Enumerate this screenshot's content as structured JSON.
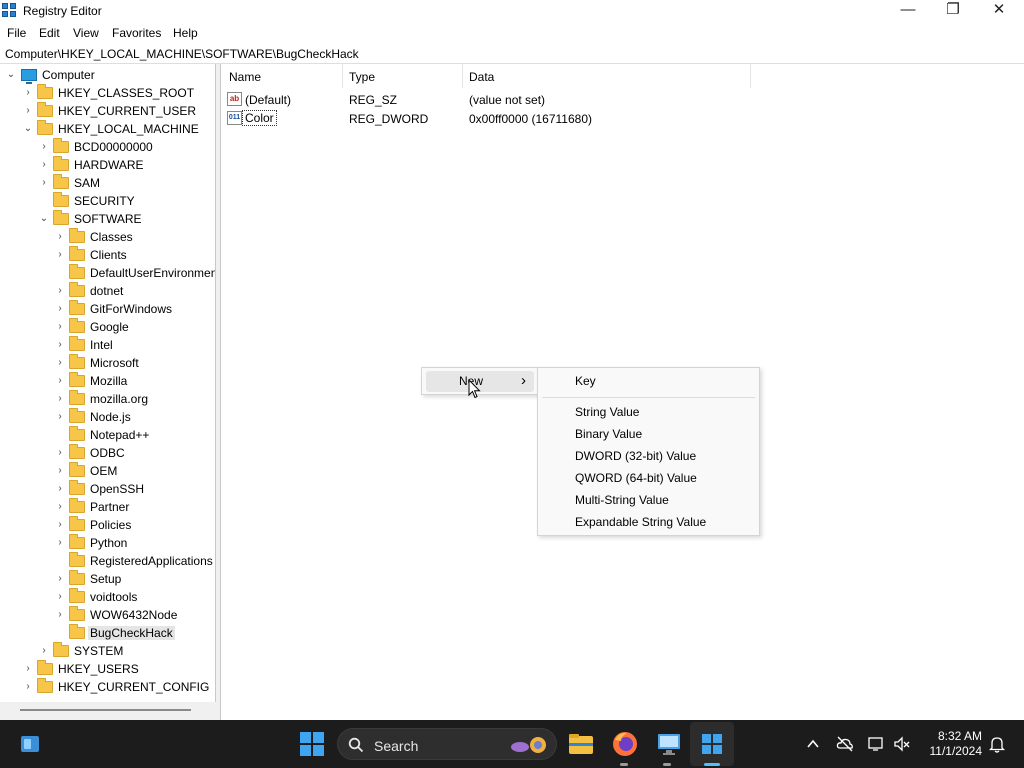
{
  "window": {
    "title": "Registry Editor",
    "minimize_glyph": "—",
    "maximize_glyph": "❐",
    "close_glyph": "✕"
  },
  "menu": [
    "File",
    "Edit",
    "View",
    "Favorites",
    "Help"
  ],
  "address": "Computer\\HKEY_LOCAL_MACHINE\\SOFTWARE\\BugCheckHack",
  "tree": {
    "root": "Computer",
    "hives": {
      "classes_root": "HKEY_CLASSES_ROOT",
      "current_user": "HKEY_CURRENT_USER",
      "local_machine": "HKEY_LOCAL_MACHINE",
      "users": "HKEY_USERS",
      "current_config": "HKEY_CURRENT_CONFIG"
    },
    "hklm_children": [
      "BCD00000000",
      "HARDWARE",
      "SAM",
      "SECURITY",
      "SOFTWARE",
      "SYSTEM"
    ],
    "software_children": [
      "Classes",
      "Clients",
      "DefaultUserEnvironmen",
      "dotnet",
      "GitForWindows",
      "Google",
      "Intel",
      "Microsoft",
      "Mozilla",
      "mozilla.org",
      "Node.js",
      "Notepad++",
      "ODBC",
      "OEM",
      "OpenSSH",
      "Partner",
      "Policies",
      "Python",
      "RegisteredApplications",
      "Setup",
      "voidtools",
      "WOW6432Node",
      "BugCheckHack"
    ],
    "selected": "BugCheckHack"
  },
  "list": {
    "columns": [
      "Name",
      "Type",
      "Data"
    ],
    "rows": [
      {
        "icon": "string-value-icon",
        "icon_text": "ab",
        "name": "(Default)",
        "type": "REG_SZ",
        "data": "(value not set)"
      },
      {
        "icon": "binary-value-icon",
        "icon_text": "011",
        "name": "Color",
        "type": "REG_DWORD",
        "data": "0x00ff0000 (16711680)"
      }
    ]
  },
  "context_menu": {
    "new_label": "New",
    "submenu_arrow": "›",
    "submenu": {
      "key": "Key",
      "items": [
        "String Value",
        "Binary Value",
        "DWORD (32-bit) Value",
        "QWORD (64-bit) Value",
        "Multi-String Value",
        "Expandable String Value"
      ]
    }
  },
  "taskbar": {
    "search_label": "Search",
    "time": "8:32 AM",
    "date": "11/1/2024",
    "colors": {
      "background": "#1c1c1c",
      "start_blue": "#3ea6f0"
    }
  }
}
